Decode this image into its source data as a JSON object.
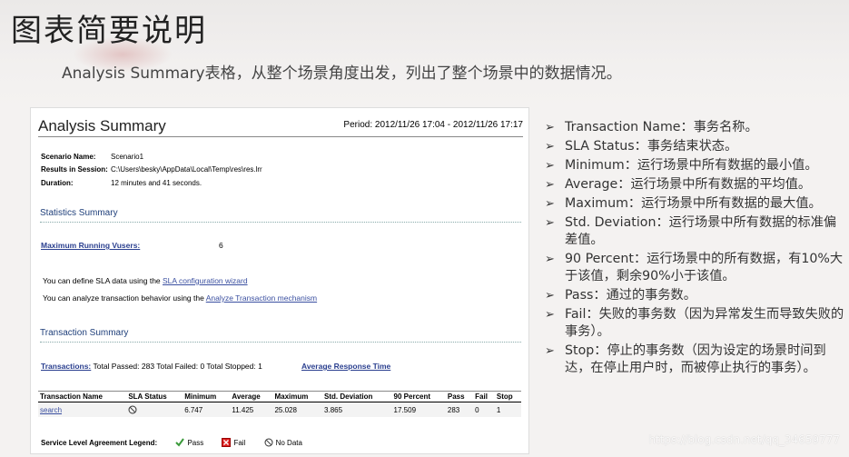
{
  "slide": {
    "title": "图表简要说明",
    "subtitle": "Analysis Summary表格，从整个场景角度出发，列出了整个场景中的数据情况。"
  },
  "report": {
    "heading": "Analysis Summary",
    "period": "Period: 2012/11/26 17:04 - 2012/11/26 17:17",
    "scenario_label": "Scenario Name:",
    "scenario_value": "Scenario1",
    "results_label": "Results in Session:",
    "results_value": "C:\\Users\\besky\\AppData\\Local\\Temp\\res\\res.lrr",
    "duration_label": "Duration:",
    "duration_value": "12 minutes and 41 seconds.",
    "stats_heading": "Statistics Summary",
    "max_vusers_label": "Maximum Running Vusers:",
    "max_vusers_value": "6",
    "sla_text": "You can define SLA data using the ",
    "sla_link": "SLA configuration wizard",
    "analyze_text": "You can analyze transaction behavior using the ",
    "analyze_link": "Analyze Transaction mechanism",
    "tx_heading": "Transaction Summary",
    "transactions_label": "Transactions:",
    "transactions_value": " Total Passed: 283 Total Failed: 0 Total Stopped: 1",
    "avg_resp_link": "Average Response Time",
    "table": {
      "headers": [
        "Transaction Name",
        "SLA Status",
        "Minimum",
        "Average",
        "Maximum",
        "Std. Deviation",
        "90 Percent",
        "Pass",
        "Fail",
        "Stop"
      ],
      "row": [
        "search",
        "",
        "6.747",
        "11.425",
        "25.028",
        "3.865",
        "17.509",
        "283",
        "0",
        "1"
      ]
    },
    "legend_label": "Service Level Agreement Legend:",
    "legend_pass": "Pass",
    "legend_fail": "Fail",
    "legend_nodata": "No Data"
  },
  "bullets": [
    "Transaction Name：事务名称。",
    "SLA Status：事务结束状态。",
    "Minimum：运行场景中所有数据的最小值。",
    "Average：运行场景中所有数据的平均值。",
    "Maximum：运行场景中所有数据的最大值。",
    "Std. Deviation：运行场景中所有数据的标准偏差值。",
    "90 Percent：运行场景中的所有数据，有10%大于该值，剩余90%小于该值。",
    "Pass：通过的事务数。",
    "Fail：失败的事务数（因为异常发生而导致失败的事务）。",
    "Stop：停止的事务数（因为设定的场景时间到达，在停止用户时，而被停止执行的事务）。"
  ],
  "watermark": "https://blog.csdn.net/qq_34659777"
}
